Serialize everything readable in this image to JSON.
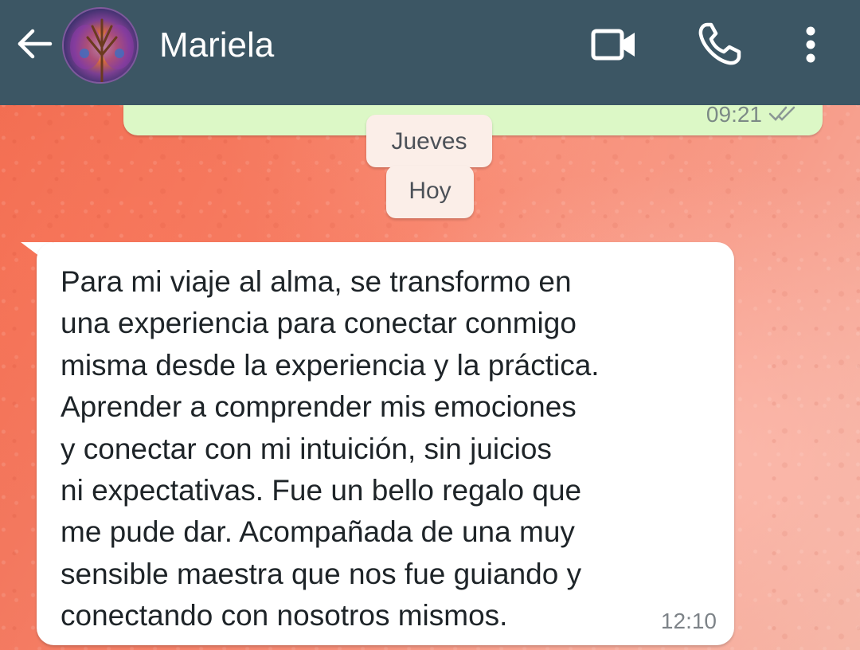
{
  "header": {
    "contact_name": "Mariela",
    "back_icon": "arrow-left-icon",
    "actions": [
      "video-camera-icon",
      "phone-icon",
      "more-vertical-icon"
    ],
    "background_color": "#3c5664"
  },
  "messages": {
    "previous_outgoing": {
      "time": "09:21",
      "status_icon": "double-check-icon"
    },
    "date_chips": [
      "Jueves",
      "Hoy"
    ],
    "incoming": {
      "text": "Para mi viaje al alma, se transformo en\nuna experiencia para conectar conmigo\nmisma desde la experiencia y la práctica.\nAprender a comprender mis emociones\ny conectar con mi intuición, sin juicios\nni expectativas. Fue un bello regalo que\nme pude dar. Acompañada de una muy\nsensible maestra que nos fue guiando y\nconectando con nosotros mismos.",
      "time": "12:10"
    }
  },
  "colors": {
    "outgoing_bubble": "#dcf8c6",
    "incoming_bubble": "#ffffff",
    "chip": "#fbeee8"
  }
}
